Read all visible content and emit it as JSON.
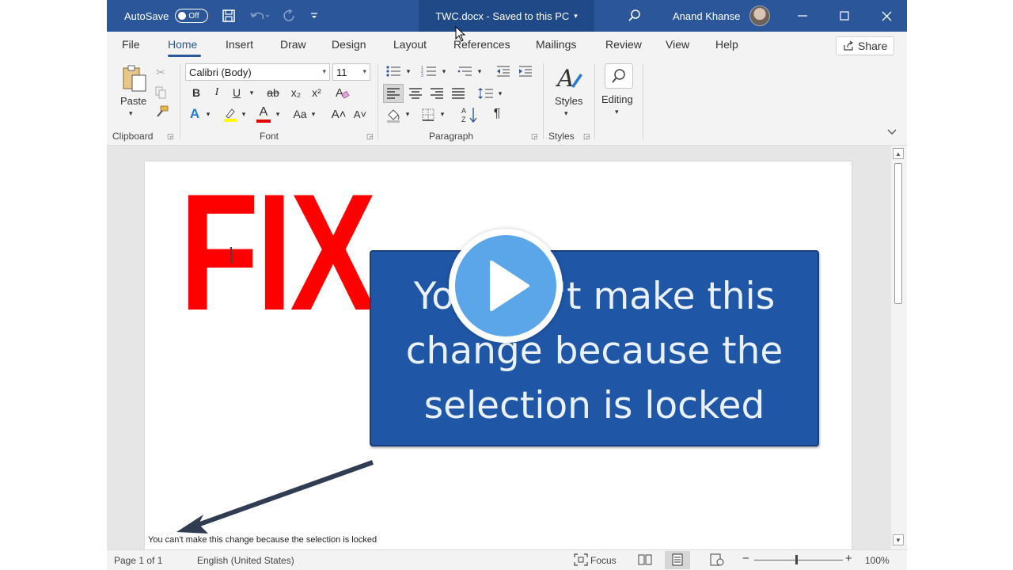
{
  "titlebar": {
    "autosave_label": "AutoSave",
    "autosave_state": "Off",
    "doc_title": "TWC.docx  -  Saved to this PC",
    "user_name": "Anand Khanse"
  },
  "tabs": [
    {
      "label": "File"
    },
    {
      "label": "Home"
    },
    {
      "label": "Insert"
    },
    {
      "label": "Draw"
    },
    {
      "label": "Design"
    },
    {
      "label": "Layout"
    },
    {
      "label": "References"
    },
    {
      "label": "Mailings"
    },
    {
      "label": "Review"
    },
    {
      "label": "View"
    },
    {
      "label": "Help"
    }
  ],
  "share_label": "Share",
  "ribbon": {
    "clipboard": {
      "paste_label": "Paste",
      "group_label": "Clipboard"
    },
    "font": {
      "font_name": "Calibri (Body)",
      "font_size": "11",
      "group_label": "Font",
      "bold": "B",
      "italic": "I",
      "underline": "U",
      "strike": "ab",
      "subscript": "x₂",
      "superscript": "x²",
      "change_case": "Aa",
      "grow": "A˄",
      "shrink": "A˅",
      "text_effects": "A",
      "font_color": "A"
    },
    "paragraph": {
      "group_label": "Paragraph",
      "pilcrow": "¶"
    },
    "styles": {
      "label": "Styles",
      "group_label": "Styles"
    },
    "editing": {
      "label": "Editing"
    }
  },
  "document": {
    "fix_text": "FIX",
    "callout_lines": [
      "You can't make this",
      "change because the",
      "selection is locked"
    ],
    "caption": "You can't make this change because the selection is locked"
  },
  "statusbar": {
    "page": "Page 1 of 1",
    "language": "English (United States)",
    "focus": "Focus",
    "zoom": "100%"
  },
  "colors": {
    "word_blue": "#2b579a",
    "callout_blue": "#1f56a6",
    "fix_red": "#ff0000",
    "play_blue": "#5aa6e8"
  }
}
